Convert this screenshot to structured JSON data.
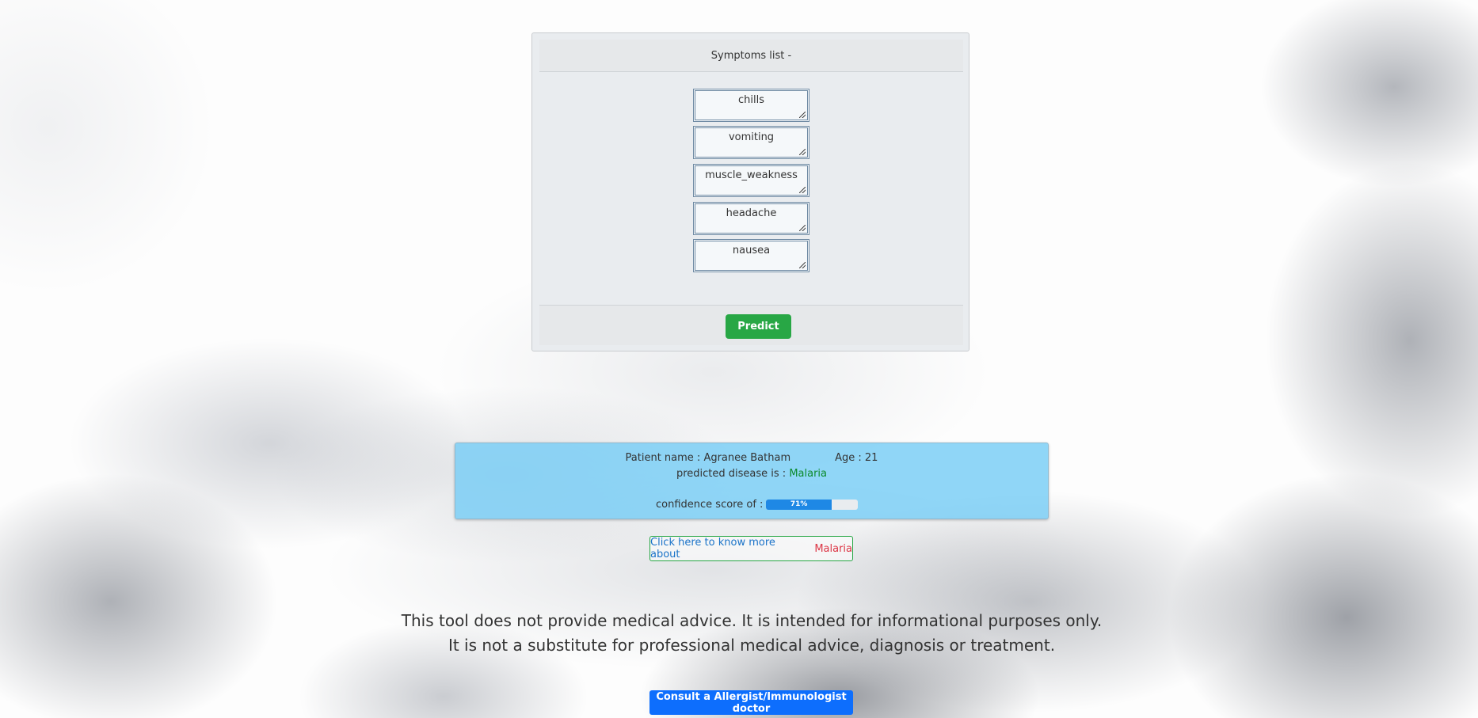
{
  "symptoms_card": {
    "header": "Symptoms list -",
    "symptoms": [
      "chills",
      "vomiting",
      "muscle_weakness",
      "headache",
      "nausea"
    ],
    "predict_label": "Predict"
  },
  "result": {
    "patient_label": "Patient name : Agranee Batham",
    "age_label": "Age : 21",
    "predicted_prefix": "predicted disease is : ",
    "disease": "Malaria",
    "confidence_label": "confidence score of :",
    "confidence_value": 71,
    "confidence_text": "71%"
  },
  "know_more": {
    "label": "Click here to know more about",
    "disease": "Malaria"
  },
  "disclaimer": {
    "line1": "This tool does not provide medical advice. It is intended for informational purposes only.",
    "line2": "It is not a substitute for professional medical advice, diagnosis or treatment."
  },
  "consult": {
    "label": "Consult a Allergist/Immunologist doctor"
  },
  "colors": {
    "predict_button": "#28a745",
    "result_panel": "#78cdf5",
    "disease_text": "#0b8a2c",
    "progress_bar": "#1e88e5",
    "know_more_border": "#28a745",
    "know_more_disease": "#dc3545",
    "consult_button": "#0d6efd"
  }
}
